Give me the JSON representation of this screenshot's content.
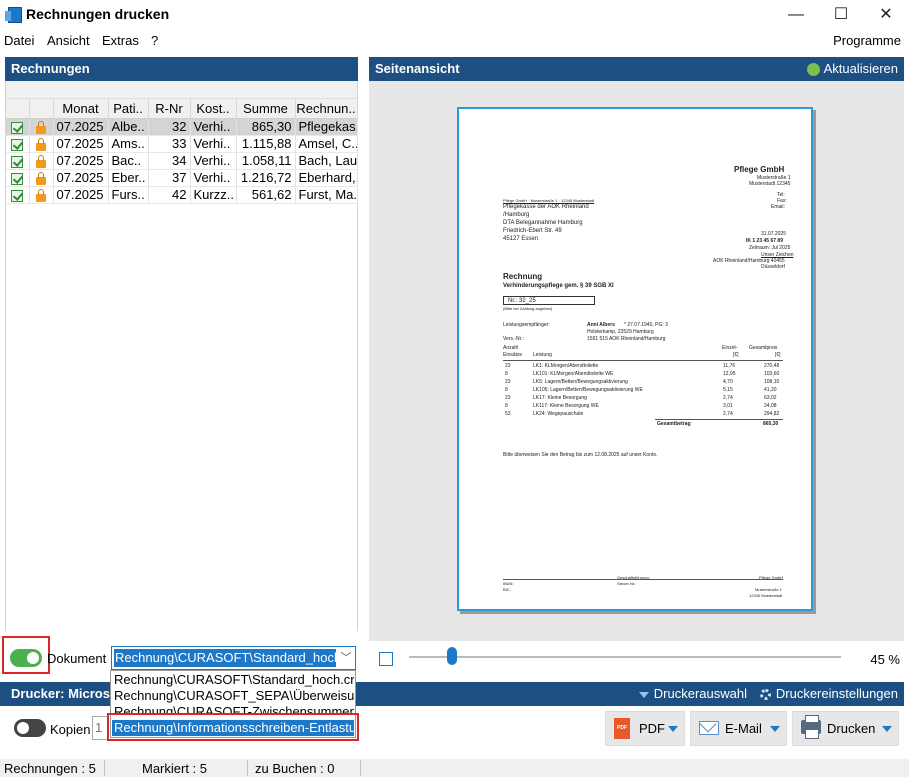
{
  "window": {
    "title": "Rechnungen drucken",
    "minimize": "—",
    "maximize": "☐",
    "close": "✕"
  },
  "menu": {
    "items": [
      "Datei",
      "Ansicht",
      "Extras",
      "?"
    ],
    "right": "Programme"
  },
  "left_panel": {
    "title": "Rechnungen",
    "columns": [
      "Monat",
      "Pati..",
      "R-Nr",
      "Kost..",
      "Summe",
      "Rechnun.."
    ],
    "rows": [
      {
        "monat": "07.2025",
        "patient": "Albe..",
        "rnr": "32",
        "kost": "Verhi..",
        "summe": "865,30",
        "rechnung": "Pflegekas..",
        "selected": true
      },
      {
        "monat": "07.2025",
        "patient": "Ams..",
        "rnr": "33",
        "kost": "Verhi..",
        "summe": "1.115,88",
        "rechnung": "Amsel, C..",
        "selected": false
      },
      {
        "monat": "07.2025",
        "patient": "Bac..",
        "rnr": "34",
        "kost": "Verhi..",
        "summe": "1.058,11",
        "rechnung": "Bach, Lau..",
        "selected": false
      },
      {
        "monat": "07.2025",
        "patient": "Eber..",
        "rnr": "37",
        "kost": "Verhi..",
        "summe": "1.216,72",
        "rechnung": "Eberhard,..",
        "selected": false
      },
      {
        "monat": "07.2025",
        "patient": "Furs..",
        "rnr": "42",
        "kost": "Kurzz..",
        "summe": "561,62",
        "rechnung": "Furst, Ma..",
        "selected": false
      }
    ]
  },
  "document": {
    "label": "Dokument",
    "selected": "Rechnung\\CURASOFT\\Standard_hoch.crd",
    "options": [
      "Rechnung\\CURASOFT\\Standard_hoch.crd",
      "Rechnung\\CURASOFT_SEPA\\Überweisung",
      "Rechnung\\CURASOFT-Zwischensummen\\S",
      "Rechnung\\Informationsschreiben-Entlastur"
    ]
  },
  "preview": {
    "title": "Seitenansicht",
    "refresh": "Aktualisieren",
    "zoom": "45 %",
    "zoom_fraction": 0.1,
    "invoice": {
      "company": "Pflege GmbH",
      "company_addr": [
        "Musterstraße 1",
        "Musterstadt 12345"
      ],
      "contact": [
        "Tel:",
        "Fax:",
        "Email:"
      ],
      "sender_line": "Pflege GmbH · Musterstraße 1 · 12345 Musterstadt",
      "recipient": [
        "Pflegekasse der AOK Rheinland",
        "/Hamburg",
        "DTA Belegannahme Hamburg",
        "Friedrich-Ebert Str. 49",
        "45127 Essen"
      ],
      "meta": [
        "31.07.2025",
        "IK 1 23 45 67 89",
        "Zeitraum: Jul 2025",
        "Unser Zeichen",
        "AOK Rheinland/Hamburg 40455",
        "Düsseldorf"
      ],
      "heading": "Rechnung",
      "subheading": "Verhinderungspflege gem. § 39 SGB XI",
      "invoice_no": "Nr.: 32_25",
      "invoice_no_hint": "(Bitte bei Zahlung angeben)",
      "recipient_label": "Leistungsempfänger:",
      "patient": "Anni Albers",
      "patient_info": "* 27.07.1940,  PG: 3",
      "patient_addr": "Holsterkamp,  22529  Hamburg",
      "insured_label": "Vers.-Nr.:",
      "insured_no": "1591 515  AOK Rheinland/Hamburg",
      "col_amount": "Anzahl",
      "col_unit": "Einsätze",
      "col_service": "Leistung",
      "col_price": "Einzel-",
      "col_price2": "[€]",
      "col_total": "Gesamtpreis",
      "col_total2": "[€]",
      "lines": [
        {
          "qty": "23",
          "service": "LK1: KLMorgen/Abendtoilette",
          "price": "11,76",
          "total": "270,48"
        },
        {
          "qty": "8",
          "service": "LK101: KLMorgen/Abendtoilette WE",
          "price": "12,95",
          "total": "103,60"
        },
        {
          "qty": "23",
          "service": "LK5: Lagern/Betten/Bewegungsaktivierung",
          "price": "4,70",
          "total": "108,10"
        },
        {
          "qty": "8",
          "service": "LK105: Lagern/Betten/Bewegungsaktivierung WE",
          "price": "5,15",
          "total": "41,20"
        },
        {
          "qty": "23",
          "service": "LK17: Kleine Besorgung",
          "price": "2,74",
          "total": "63,02"
        },
        {
          "qty": "8",
          "service": "LK117: Kleine Besorgung WE",
          "price": "3,01",
          "total": "24,08"
        },
        {
          "qty": "53",
          "service": "LK24: Wegepauschale",
          "price": "2,74",
          "total": "294,82"
        }
      ],
      "total_label": "Gesamtbetrag",
      "total": "865,30",
      "payment_note": "Bitte überweisen Sie den Betrag bis zum 12.08.2025 auf unser Konto.",
      "footer_left": [
        "IBAN:",
        "BIC:"
      ],
      "footer_mid": [
        "Geschäftsführung:",
        "Steuer-Nr.:"
      ],
      "footer_right": [
        "Pflege GmbH",
        "Musterstraße 1",
        "12345 Musterstadt"
      ]
    }
  },
  "printer": {
    "title": "Drucker: Micros",
    "select": "Druckerauswahl",
    "settings": "Druckereinstellungen",
    "copies_label": "Kopien",
    "copies": "1",
    "pdf": "PDF",
    "pdf_icon_text": "PDF",
    "email": "E-Mail",
    "print": "Drucken"
  },
  "status": {
    "rechnungen": "Rechnungen : 5",
    "markiert": "Markiert : 5",
    "zu_buchen": "zu Buchen : 0"
  }
}
